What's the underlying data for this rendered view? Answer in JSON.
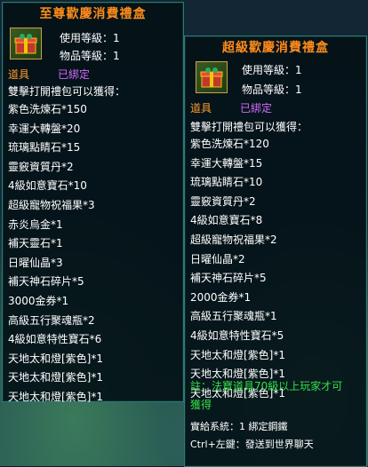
{
  "colors": {
    "title": "#ff8c1a",
    "item_type": "#ff9c2e",
    "bound": "#d36bff",
    "note": "#35e04a",
    "text": "#ffffff",
    "border": "#2f7a72"
  },
  "left_tooltip": {
    "title": "至尊歡慶消費禮盒",
    "icon": "gift-box-icon",
    "use_level": "使用等級：1",
    "item_level": "物品等級：1",
    "item_type": "道具",
    "bound": "已綁定",
    "header": "雙擊打開禮包可以獲得：",
    "items": [
      "紫色洗煉石*150",
      "幸運大轉盤*20",
      "琉璃點睛石*15",
      "靈竅資質丹*2",
      "4級如意寶石*10",
      "超級寵物祝福果*3",
      "赤炎烏金*1",
      "補天靈石*1",
      "日曜仙晶*3",
      "補天神石碎片*5",
      "3000金券*1",
      "高級五行聚魂瓶*2",
      "4級如意特性寶石*6",
      "天地太和燈[紫色]*1",
      "天地太和燈[紫色]*1",
      "天地太和燈[紫色]*1"
    ]
  },
  "right_tooltip": {
    "title": "超級歡慶消費禮盒",
    "icon": "gift-box-icon",
    "use_level": "使用等級：1",
    "item_level": "物品等級：1",
    "item_type": "道具",
    "bound": "已綁定",
    "header": "雙擊打開禮包可以獲得：",
    "items": [
      "紫色洗煉石*120",
      "幸運大轉盤*15",
      "琉璃點睛石*10",
      "靈竅資質丹*2",
      "4級如意寶石*8",
      "超級寵物祝福果*2",
      "日曜仙晶*2",
      "補天神石碎片*5",
      "2000金券*1",
      "高級五行聚魂瓶*1",
      "4級如意特性寶石*5",
      "天地太和燈[紫色]*1",
      "天地太和燈[紫色]*1",
      "天地太和燈[紫色]*1"
    ],
    "note_line1": "註：法寶道具70級以上玩家才可",
    "note_line2": "獲得",
    "footer_line1": "實給系統：1 綁定鋼鐵",
    "footer_line2": "Ctrl+左鍵：發送到世界聊天"
  }
}
